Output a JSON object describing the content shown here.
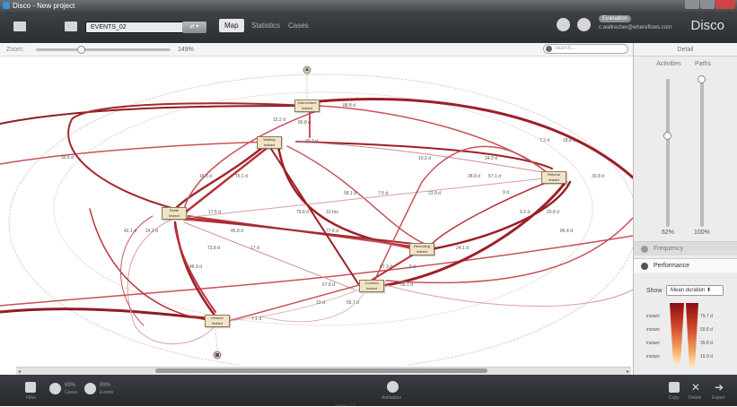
{
  "window": {
    "title": "Disco - New project"
  },
  "toolbar": {
    "dataset_name": "EVENTS_02",
    "dataset_button": "⇄ ▾",
    "tabs": {
      "map": "Map",
      "statistics": "Statistics",
      "cases": "Cases"
    },
    "user_name": "Evaluation",
    "user_email": "c.wallrecher@whereflows.com",
    "brand": "Disco"
  },
  "zoom": {
    "label": "Zoom:",
    "value_text": "149%",
    "slider_fraction": 0.33
  },
  "search": {
    "placeholder": "search..."
  },
  "detail": {
    "header": "Detail",
    "activities_label": "Activities",
    "paths_label": "Paths",
    "activities_pct": "62%",
    "paths_pct": "100%",
    "activities_fraction": 0.62,
    "paths_fraction": 1.0
  },
  "side_buttons": {
    "frequency": "Frequency",
    "performance": "Performance"
  },
  "performance": {
    "show_label": "Show",
    "metric": "Mean duration  ⬍",
    "legend_rows": [
      {
        "label": "instant",
        "value": "79.7 d"
      },
      {
        "label": "instant",
        "value": "59.8 d"
      },
      {
        "label": "instant",
        "value": "39.8 d"
      },
      {
        "label": "instant",
        "value": "19.9 d"
      }
    ]
  },
  "map": {
    "nodes": [
      {
        "name": "Intervenient",
        "duration": "instant"
      },
      {
        "name": "Waiting",
        "duration": "instant"
      },
      {
        "name": "Returns",
        "duration": "instant"
      },
      {
        "name": "Retail",
        "duration": "instant"
      },
      {
        "name": "Recruiting",
        "duration": "instant"
      },
      {
        "name": "Contract",
        "duration": "instant"
      },
      {
        "name": "Intranet",
        "duration": "instant"
      }
    ],
    "edge_labels": [
      "88.8 d",
      "15.2 d",
      "22.2 d",
      "39.6 d",
      "80.8 d",
      "76.1 d",
      "16.3 d",
      "10.2 d",
      "24.2 d",
      "7.2 d",
      "18.8 d",
      "38.8 d",
      "57.1 d",
      "9 d",
      "56.1 d",
      "7.5 d",
      "23.9 d",
      "9.2 d",
      "20.8 d",
      "42.1 d",
      "24.2 d",
      "45.8 d",
      "79.8 d",
      "10 hrs",
      "77.6 d",
      "73.8 d",
      "17 d",
      "46.9 d",
      "67.3 d",
      "5 d",
      "58.1 d",
      "55.7 d",
      "13 d",
      "67.8 d",
      "30.8 d",
      "86.4 d",
      "24.1 d",
      "17.5 d",
      "7.1 d"
    ]
  },
  "statusbar": {
    "filter_label": "Filter",
    "cases_pct": "99%",
    "cases_label": "Cases",
    "events_pct": "99%",
    "events_label": "Events",
    "animation_label": "Animation",
    "copy_label": "Copy",
    "delete_label": "Delete",
    "export_label": "Export",
    "version": "version 1.7.0"
  },
  "colors": {
    "toolbar_dark": "#2b2e32",
    "node_fill": "#f1e3c6",
    "edge_red": "#b3202a",
    "edge_light": "#e7b5b8"
  }
}
